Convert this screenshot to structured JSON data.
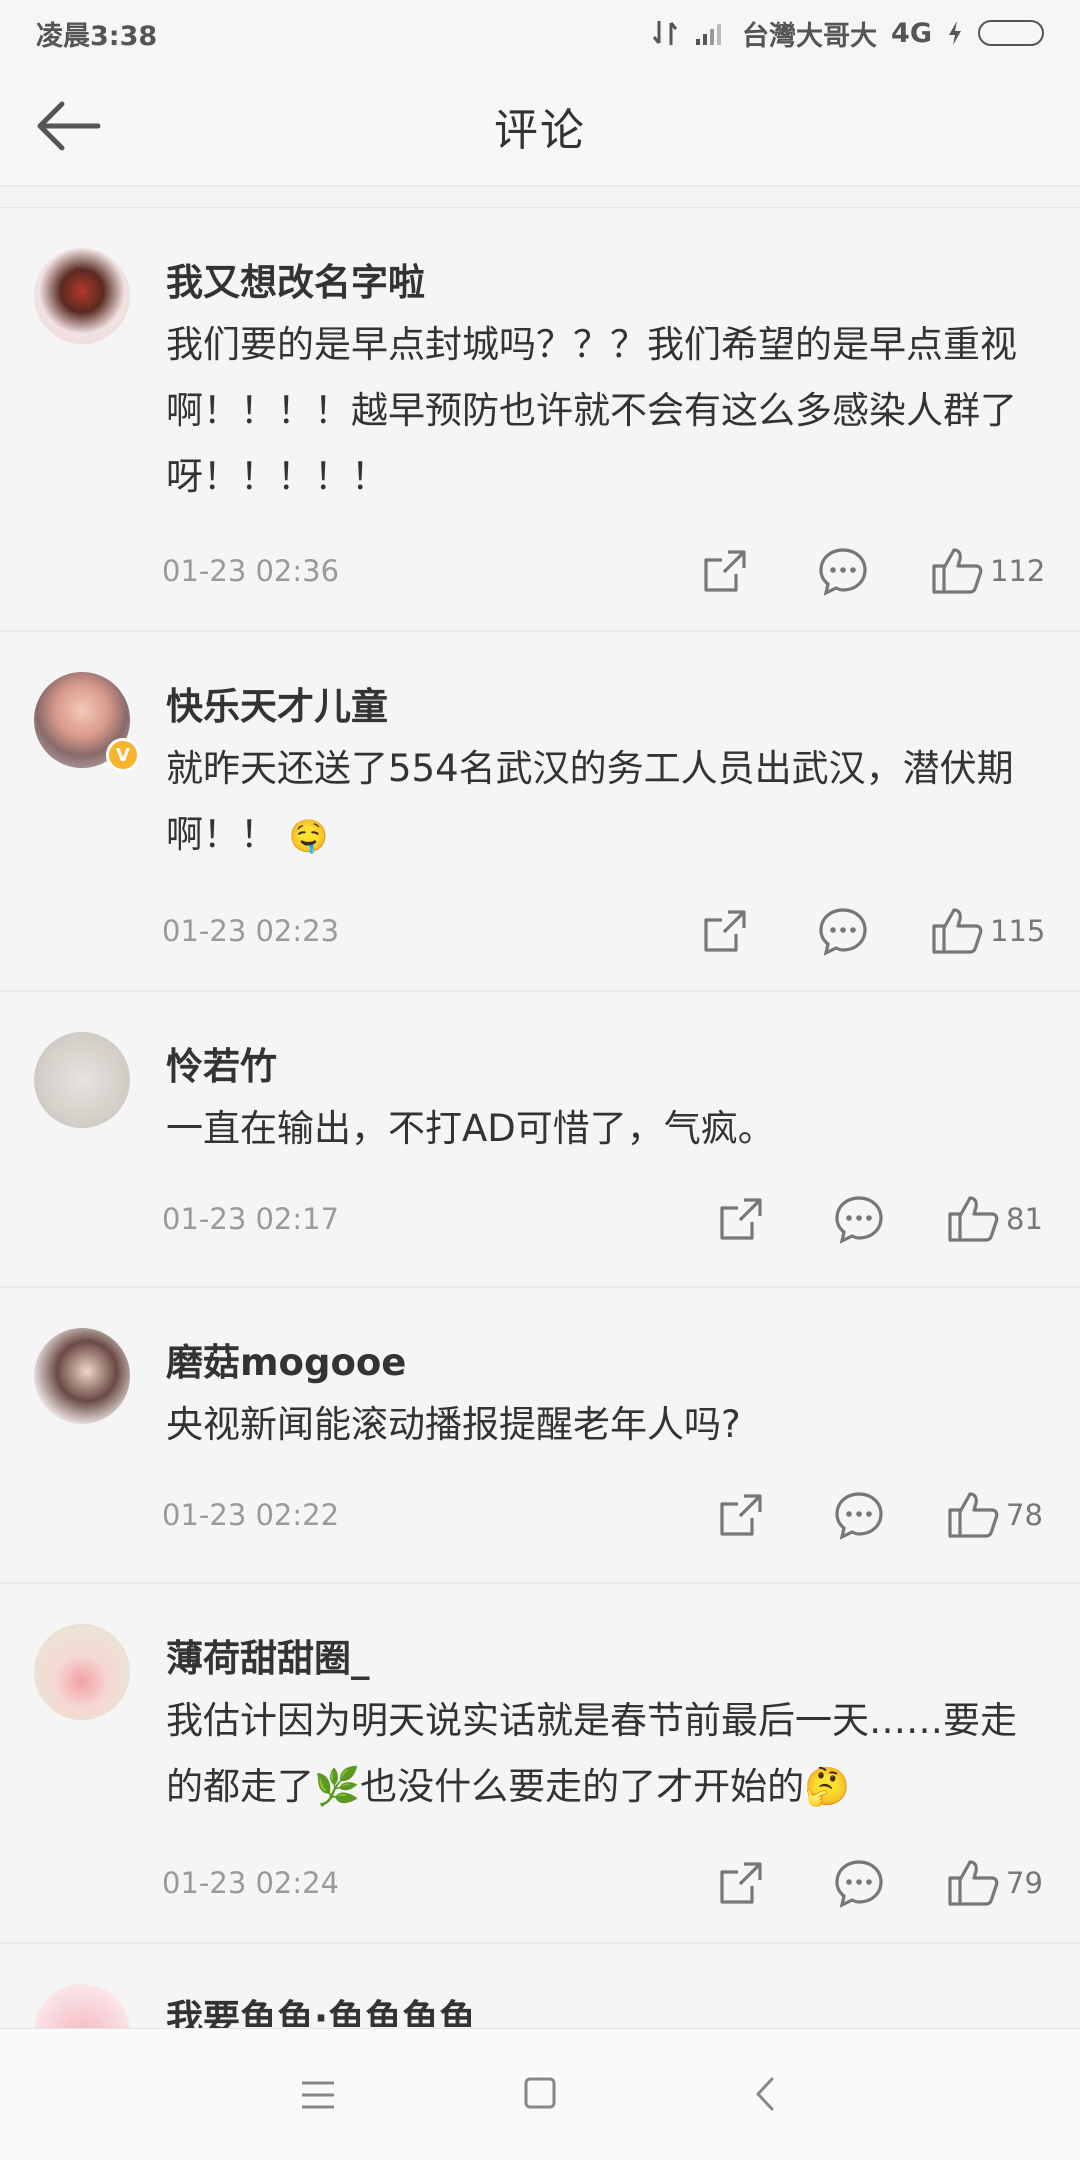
{
  "status": {
    "time": "凌晨3:38",
    "carrier": "台灣大哥大",
    "network": "4G"
  },
  "header": {
    "title": "评论"
  },
  "comments": [
    {
      "name": "我又想改名字啦",
      "text": "我们要的是早点封城吗？？？我们希望的是早点重视啊！！！！越早预防也许就不会有这么多感染人群了呀！！！！！",
      "time": "01-23 02:36",
      "likes": "112",
      "verified": false
    },
    {
      "name": "快乐天才儿童",
      "text": "就昨天还送了554名武汉的务工人员出武汉，潜伏期啊！！",
      "time": "01-23 02:23",
      "likes": "115",
      "verified": true,
      "emoji": "🤤"
    },
    {
      "name": "怜若竹",
      "text": "一直在输出，不打AD可惜了，气疯。",
      "time": "01-23 02:17",
      "likes": "81",
      "verified": false
    },
    {
      "name": "磨菇mogooe",
      "text": "央视新闻能滚动播报提醒老年人吗?",
      "time": "01-23 02:22",
      "likes": "78",
      "verified": false
    },
    {
      "name": "薄荷甜甜圈_",
      "text": "我估计因为明天说实话就是春节前最后一天……要走的都走了🌿也没什么要走的了才开始的🤔",
      "time": "01-23 02:24",
      "likes": "79",
      "verified": false
    },
    {
      "name": "我要鱼鱼·鱼鱼鱼鱼"
    }
  ],
  "icons": {
    "back": "arrow-left-icon",
    "share": "share-icon",
    "reply": "comment-bubble-icon",
    "like": "thumbs-up-icon",
    "nav_menu": "menu-icon",
    "nav_home": "home-square-icon",
    "nav_back": "chevron-left-icon",
    "verified": "verified-badge-icon"
  },
  "colors": {
    "verified": "#f7b52c",
    "meta": "#9a9a9a"
  }
}
